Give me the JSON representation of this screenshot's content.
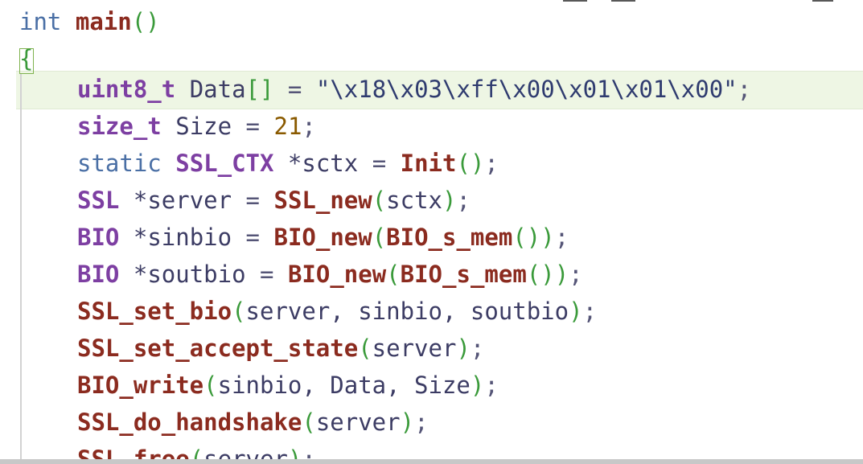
{
  "editor": {
    "language": "c",
    "lines": [
      {
        "id": "l0",
        "tokens": [
          "int",
          "main",
          "()"
        ]
      },
      {
        "id": "l1",
        "tokens": [
          "{"
        ]
      },
      {
        "id": "l2",
        "tokens": [
          "uint8_t",
          "Data",
          "[]",
          "=",
          "\"\\x18\\x03\\xff\\x00\\x01\\x01\\x00\"",
          ";"
        ]
      },
      {
        "id": "l3",
        "tokens": [
          "size_t",
          "Size",
          "=",
          "21",
          ";"
        ]
      },
      {
        "id": "l4",
        "tokens": [
          "static",
          "SSL_CTX",
          "*sctx",
          "=",
          "Init",
          "()",
          ";"
        ]
      },
      {
        "id": "l5",
        "tokens": [
          "SSL",
          "*server",
          "=",
          "SSL_new",
          "(",
          "sctx",
          ")",
          ";"
        ]
      },
      {
        "id": "l6",
        "tokens": [
          "BIO",
          "*sinbio",
          "=",
          "BIO_new",
          "(",
          "BIO_s_mem",
          "()",
          ")",
          ";"
        ]
      },
      {
        "id": "l7",
        "tokens": [
          "BIO",
          "*soutbio",
          "=",
          "BIO_new",
          "(",
          "BIO_s_mem",
          "()",
          ")",
          ";"
        ]
      },
      {
        "id": "l8",
        "tokens": [
          "SSL_set_bio",
          "(",
          "server, sinbio, soutbio",
          ")",
          ";"
        ]
      },
      {
        "id": "l9",
        "tokens": [
          "SSL_set_accept_state",
          "(",
          "server",
          ")",
          ";"
        ]
      },
      {
        "id": "l10",
        "tokens": [
          "BIO_write",
          "(",
          "sinbio, Data, Size",
          ")",
          ";"
        ]
      },
      {
        "id": "l11",
        "tokens": [
          "SSL_do_handshake",
          "(",
          "server",
          ")",
          ";"
        ]
      },
      {
        "id": "l12",
        "tokens": [
          "SSL_free",
          "(",
          "server",
          ")",
          ";"
        ]
      }
    ]
  },
  "colors": {
    "background": "#ffffff",
    "highlight_line": "#eef6e4",
    "keyword": "#4a6fa5",
    "type": "#7d3fa2",
    "function": "#8b2b1f",
    "punctuation": "#3a9a3a",
    "number": "#8a5a00"
  }
}
